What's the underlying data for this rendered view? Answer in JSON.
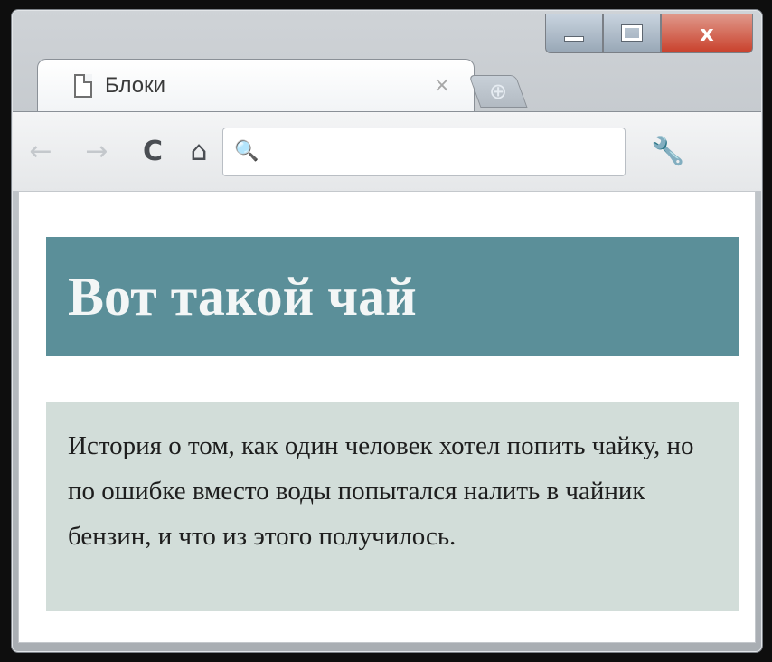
{
  "browser": {
    "tab": {
      "title": "Блоки",
      "close_glyph": "×"
    },
    "new_tab_glyph": "⊕",
    "window_controls": {
      "close_glyph": "x"
    },
    "toolbar": {
      "back_glyph": "←",
      "forward_glyph": "→",
      "reload_glyph": "C",
      "home_glyph": "⌂",
      "wrench_glyph": "🔧",
      "search_glyph": "🔍",
      "address_value": ""
    }
  },
  "page": {
    "heading": "Вот такой чай",
    "paragraph": "История о том, как один человек хотел попить чайку, но по ошибке вместо воды попытался налить в чайник бензин, и что из этого получилось.",
    "colors": {
      "heading_background": "#5b8f99",
      "paragraph_background": "#d2ddd9"
    }
  }
}
